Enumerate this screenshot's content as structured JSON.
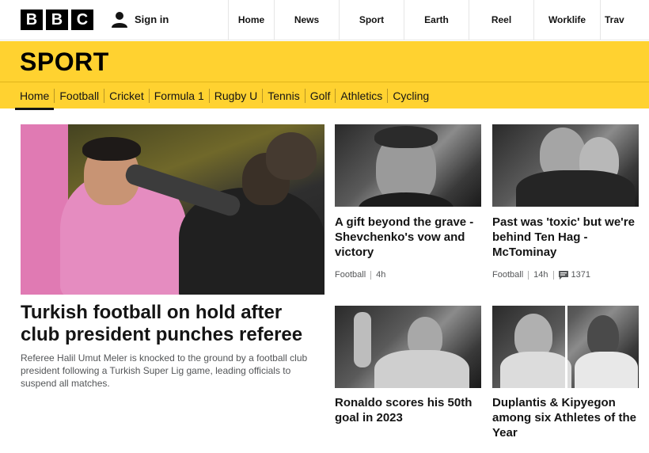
{
  "header": {
    "logo_letters": [
      "B",
      "B",
      "C"
    ],
    "signin_label": "Sign in",
    "nav": [
      "Home",
      "News",
      "Sport",
      "Earth",
      "Reel",
      "Worklife",
      "Travel"
    ]
  },
  "sport": {
    "title": "SPORT",
    "tabs": [
      "Home",
      "Football",
      "Cricket",
      "Formula 1",
      "Rugby U",
      "Tennis",
      "Golf",
      "Athletics",
      "Cycling"
    ],
    "active_tab": "Home"
  },
  "main_story": {
    "headline": "Turkish football on hold after club president punches referee",
    "summary": "Referee Halil Umut Meler is knocked to the ground by a football club president following a Turkish Super Lig game, leading officials to suspend all matches."
  },
  "cards": [
    {
      "headline": "A gift beyond the grave - Shevchenko's vow and victory",
      "section": "Football",
      "time": "4h"
    },
    {
      "headline": "Past was 'toxic' but we're behind Ten Hag - McTominay",
      "section": "Football",
      "time": "14h",
      "comments": "1371"
    },
    {
      "headline": "Ronaldo scores his 50th goal in 2023"
    },
    {
      "headline": "Duplantis & Kipyegon among six Athletes of the Year"
    }
  ],
  "colors": {
    "sport_yellow": "#ffd230",
    "text": "#141414",
    "meta": "#545658"
  }
}
